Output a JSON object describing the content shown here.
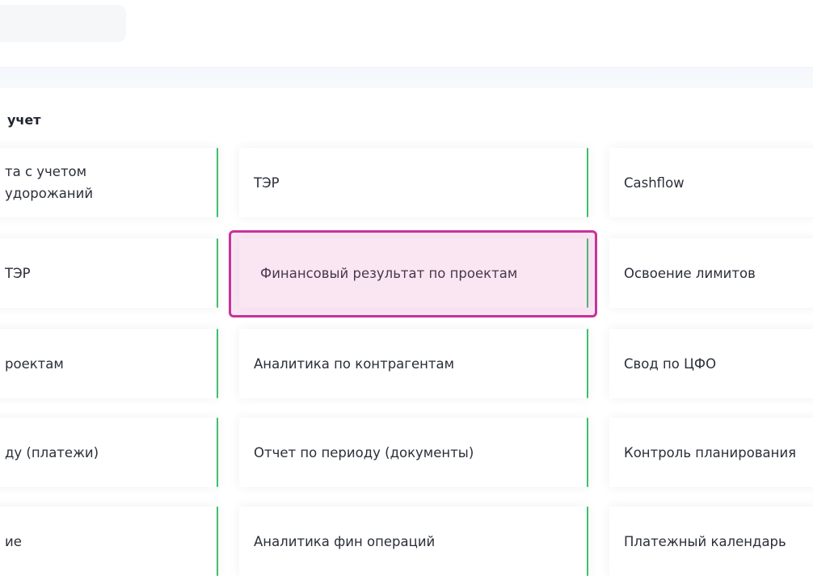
{
  "section": {
    "title": "учет"
  },
  "grid": {
    "rows": [
      [
        "та с учетом\nудорожаний",
        "ТЭР",
        "Cashflow"
      ],
      [
        "ТЭР",
        "Финансовый результат по проектам",
        "Освоение лимитов"
      ],
      [
        "роектам",
        "Аналитика по контрагентам",
        "Свод по ЦФО"
      ],
      [
        "ду (платежи)",
        "Отчет по периоду (документы)",
        "Контроль планирования"
      ],
      [
        "ие",
        "Аналитика фин операций",
        "Платежный календарь"
      ]
    ]
  },
  "highlight": {
    "target": "Финансовый результат по проектам",
    "color": "#c8329a"
  },
  "colors": {
    "card_accent": "#3fbf6b",
    "band": "#f4f8fc"
  }
}
